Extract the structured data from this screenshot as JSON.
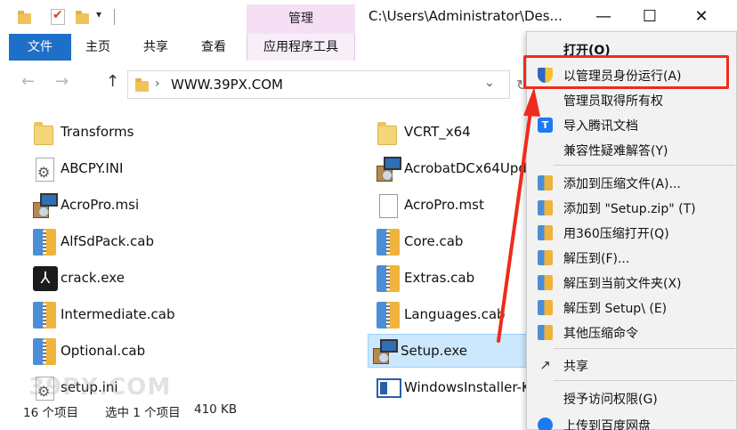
{
  "titlebar": {
    "manage_label": "管理",
    "path": "C:\\Users\\Administrator\\Des...",
    "minimize": "—",
    "maximize": "☐",
    "close": "✕"
  },
  "ribbon": {
    "tabs": [
      "文件",
      "主页",
      "共享",
      "查看",
      "应用程序工具"
    ]
  },
  "address": {
    "path": "WWW.39PX.COM",
    "chevron": "›",
    "dropdown": "⌄",
    "back": "←",
    "forward": "→",
    "up": "↑",
    "refresh": "↻"
  },
  "files": [
    {
      "name": "Transforms",
      "icon": "folder-icon"
    },
    {
      "name": "VCRT_x64",
      "icon": "folder-icon"
    },
    {
      "name": "ABCPY.INI",
      "icon": "settings-file-icon"
    },
    {
      "name": "AcrobatDCx64Upd",
      "icon": "installer-icon"
    },
    {
      "name": "AcroPro.msi",
      "icon": "installer-icon"
    },
    {
      "name": "AcroPro.mst",
      "icon": "document-icon"
    },
    {
      "name": "AlfSdPack.cab",
      "icon": "cab-archive-icon"
    },
    {
      "name": "Core.cab",
      "icon": "cab-archive-icon"
    },
    {
      "name": "crack.exe",
      "icon": "pdf-app-icon"
    },
    {
      "name": "Extras.cab",
      "icon": "cab-archive-icon"
    },
    {
      "name": "Intermediate.cab",
      "icon": "cab-archive-icon"
    },
    {
      "name": "Languages.cab",
      "icon": "cab-archive-icon"
    },
    {
      "name": "Optional.cab",
      "icon": "cab-archive-icon"
    },
    {
      "name": "Setup.exe",
      "icon": "installer-icon",
      "selected": true
    },
    {
      "name": "setup.ini",
      "icon": "settings-file-icon"
    },
    {
      "name": "WindowsInstaller-K",
      "icon": "windows-installer-icon"
    }
  ],
  "status": {
    "count": "16 个项目",
    "selected": "选中 1 个项目",
    "size": "410 KB"
  },
  "watermark": "39PX.COM",
  "context_menu": {
    "items": [
      {
        "label": "打开(O)",
        "bold": true,
        "icon": ""
      },
      {
        "label": "以管理员身份运行(A)",
        "icon": "uac-shield-icon"
      },
      {
        "label": "管理员取得所有权",
        "icon": ""
      },
      {
        "label": "导入腾讯文档",
        "icon": "tencent-docs-icon"
      },
      {
        "label": "兼容性疑难解答(Y)",
        "icon": ""
      },
      {
        "label": "添加到压缩文件(A)...",
        "icon": "archive-icon"
      },
      {
        "label": "添加到 \"Setup.zip\" (T)",
        "icon": "archive-icon"
      },
      {
        "label": "用360压缩打开(Q)",
        "icon": "archive-icon"
      },
      {
        "label": "解压到(F)...",
        "icon": "archive-icon"
      },
      {
        "label": "解压到当前文件夹(X)",
        "icon": "archive-icon"
      },
      {
        "label": "解压到 Setup\\ (E)",
        "icon": "archive-icon"
      },
      {
        "label": "其他压缩命令",
        "icon": "archive-icon"
      },
      {
        "label": "共享",
        "icon": "share-icon"
      },
      {
        "label": "授予访问权限(G)",
        "icon": ""
      },
      {
        "label": "上传到百度网盘",
        "icon": "cloud-icon"
      }
    ]
  },
  "colors": {
    "accent": "#1e6fc7",
    "manage_tab": "#f4dff5",
    "selection": "#cce8ff",
    "highlight": "#f02b1d"
  }
}
